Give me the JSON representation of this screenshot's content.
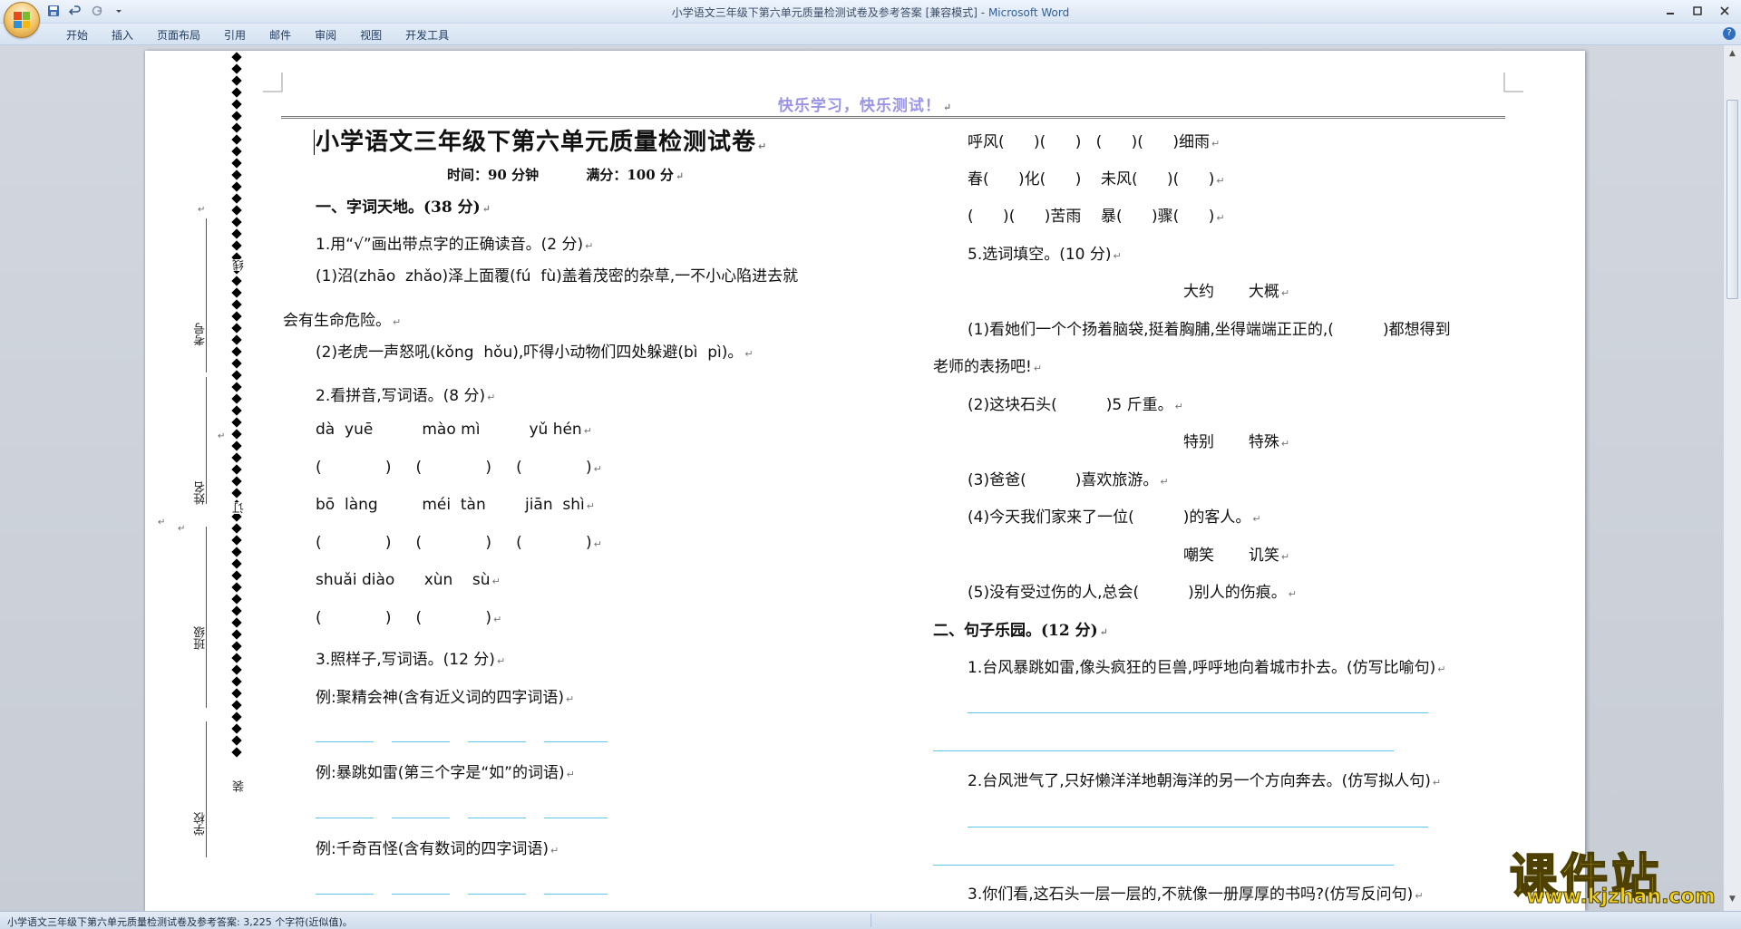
{
  "window": {
    "title": "小学语文三年级下第六单元质量检测试卷及参考答案 [兼容模式]",
    "app_name": "Microsoft Word",
    "title_separator": " - "
  },
  "ribbon": {
    "tabs": [
      "开始",
      "插入",
      "页面布局",
      "引用",
      "邮件",
      "审阅",
      "视图",
      "开发工具"
    ]
  },
  "statusbar": {
    "text": "小学语文三年级下第六单元质量检测试卷及参考答案: 3,225 个字符(近似值)。"
  },
  "document": {
    "header": "快乐学习，快乐测试！",
    "binding_margin": {
      "labels": [
        "考号",
        "姓名",
        "班级",
        "学校"
      ],
      "binding_chars": [
        "线",
        "订",
        "装"
      ]
    },
    "title": "小学语文三年级下第六单元质量检测试卷",
    "time_score": "时间：90 分钟          满分：100 分",
    "left_column": [
      "一、字词天地。(38 分)",
      "1.用“√”画出带点字的正确读音。(2 分)",
      "(1)沼(zhāo  zhǎo)泽上面覆(fú  fù)盖着茂密的杂草,一不小心陷进去就",
      "会有生命危险。",
      "(2)老虎一声怒吼(kǒng  hǒu),吓得小动物们四处躲避(bì  pì)。",
      "2.看拼音,写词语。(8 分)",
      "dà  yuē          mào mì          yǔ hén",
      "(             )     (             )     (             )",
      "bō  làng         méi  tàn        jiān  shì",
      "(             )     (             )     (             )",
      "shuǎi diào      xùn    sù",
      "(             )     (             )",
      "3.照样子,写词语。(12 分)",
      "例:聚精会神(含有近义词的四字词语)",
      "例:暴跳如雷(第三个字是“如”的词语)",
      "例:千奇百怪(含有数词的四字词语)"
    ],
    "right_column": [
      "呼风(      )(      )   (      )(      )细雨",
      "春(      )化(      )    未风(      )(      )",
      "(      )(      )苦雨    暴(      )骤(      )",
      "5.选词填空。(10 分)",
      "大约       大概",
      "(1)看她们一个个扬着脑袋,挺着胸脯,坐得端端正正的,(          )都想得到",
      "老师的表扬吧!",
      "(2)这块石头(          )5 斤重。",
      "特别       特殊",
      "(3)爸爸(          )喜欢旅游。",
      "(4)今天我们家来了一位(          )的客人。",
      "嘲笑       讥笑",
      "(5)没有受过伤的人,总会(          )别人的伤痕。",
      "二、句子乐园。(12 分)",
      "1.台风暴跳如雷,像头疯狂的巨兽,呼呼地向着城市扑去。(仿写比喻句)",
      "2.台风泄气了,只好懒洋洋地朝海洋的另一个方向奔去。(仿写拟人句)",
      "3.你们看,这石头一层一层的,不就像一册厚厚的书吗?(仿写反问句)"
    ],
    "paragraph_mark": "↵"
  },
  "watermark": {
    "main": "课件站",
    "url": "www.kjzhan.com"
  },
  "icons": [
    "office-button-icon",
    "save-icon",
    "undo-icon",
    "redo-icon",
    "customize-qat-icon",
    "minimize-icon",
    "maximize-icon",
    "close-icon",
    "help-icon",
    "scroll-up-icon",
    "scroll-down-icon"
  ]
}
